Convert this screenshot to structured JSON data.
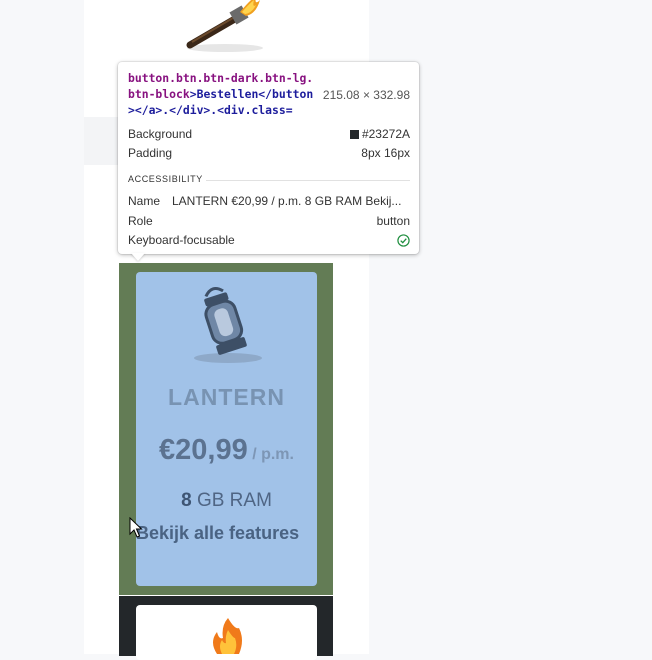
{
  "tooltip": {
    "selector_class": "button.btn.btn-dark.btn-lg.btn-block",
    "selector_rest": ">Bestellen</button></a>.</div>.<div.class=",
    "dimensions": "215.08 × 332.98",
    "background_label": "Background",
    "background_value": "#23272A",
    "padding_label": "Padding",
    "padding_value": "8px 16px",
    "section_title": "ACCESSIBILITY",
    "name_label": "Name",
    "name_value": "LANTERN €20,99 / p.m. 8 GB RAM Bekij...",
    "role_label": "Role",
    "role_value": "button",
    "focus_label": "Keyboard-focusable"
  },
  "card": {
    "title": "LANTERN",
    "price": "€20,99",
    "period": "/ p.m.",
    "ram_amount": "8",
    "ram_unit": "GB RAM",
    "features_link": "Bekijk alle features"
  },
  "colors": {
    "highlight_margin": "#637c55",
    "highlight_content": "#a1c2e8",
    "button_dark": "#23272a",
    "check_green": "#1e8e3e"
  },
  "icons": [
    "torch-icon",
    "lantern-icon",
    "fire-icon",
    "check-icon",
    "cursor-icon"
  ]
}
